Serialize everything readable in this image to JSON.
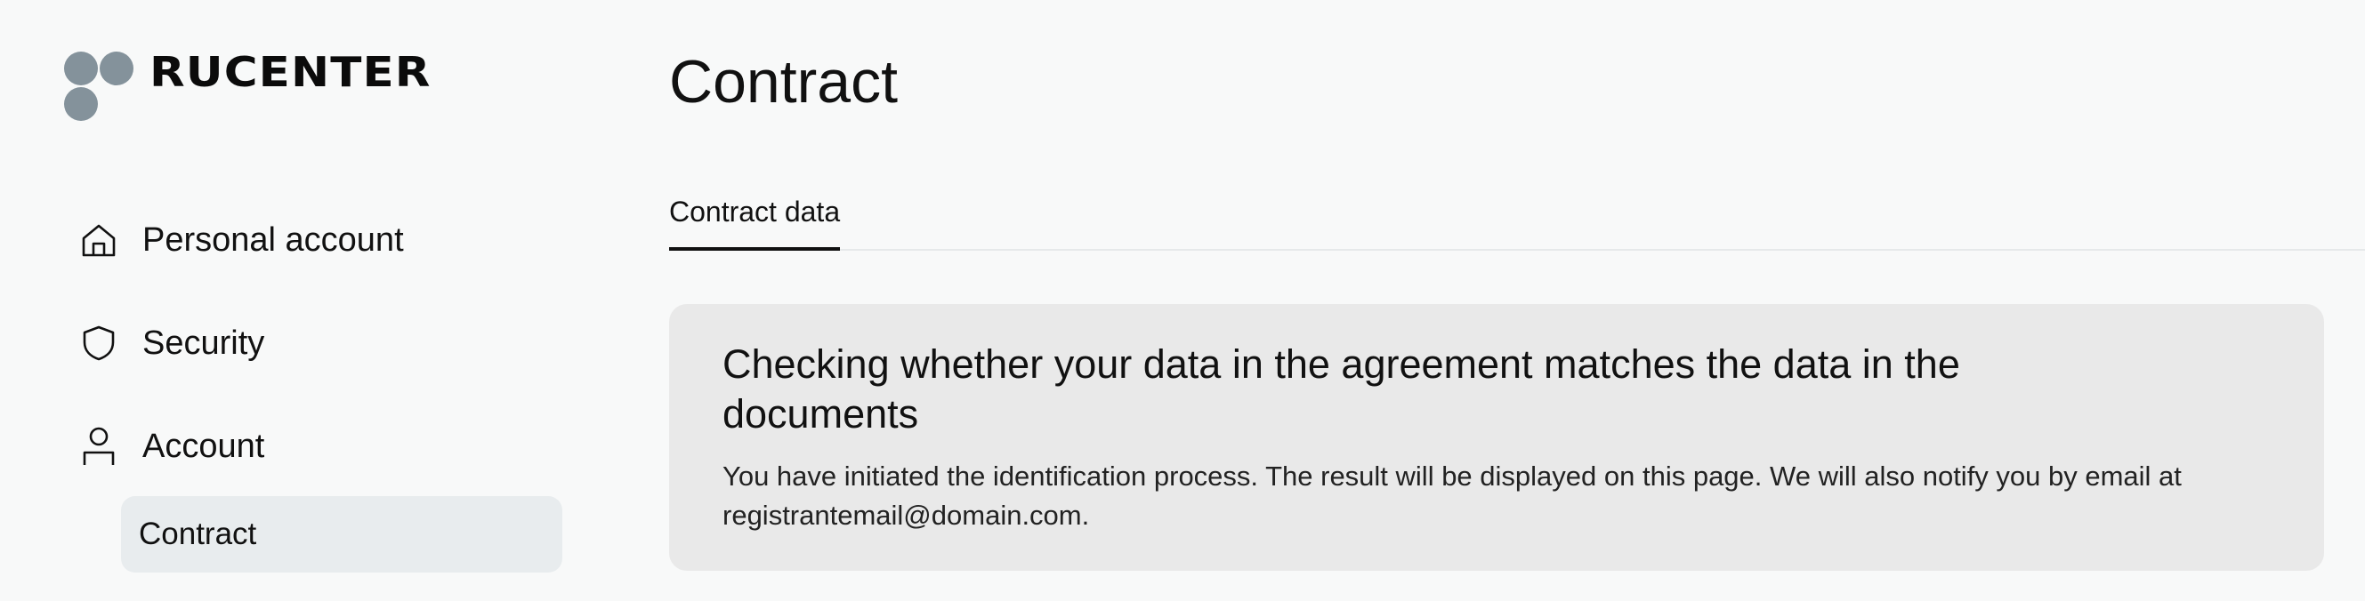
{
  "brand": {
    "name": "RUCENTER",
    "logo_color": "#84929b"
  },
  "sidebar": {
    "items": [
      {
        "label": "Personal account",
        "icon": "home-icon"
      },
      {
        "label": "Security",
        "icon": "shield-icon"
      },
      {
        "label": "Account",
        "icon": "user-icon"
      }
    ],
    "sub_items": [
      {
        "label": "Contract",
        "active": true
      }
    ]
  },
  "main": {
    "title": "Contract",
    "tabs": [
      {
        "label": "Contract data",
        "active": true
      }
    ],
    "notice": {
      "title": "Checking whether your data in the agreement matches the data in the documents",
      "text": "You have initiated the identification process. The result will be displayed on this page. We will also notify you by email at registrantemail@domain.com."
    }
  },
  "colors": {
    "background": "#f8f9f9",
    "active_nav_bg": "#e8ecee",
    "notice_bg": "#e9e9e9",
    "text": "#111111"
  }
}
